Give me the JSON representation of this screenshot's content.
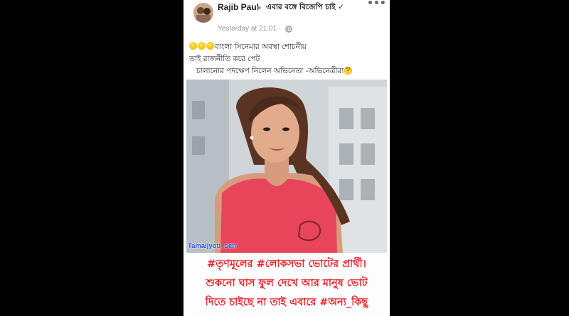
{
  "post": {
    "author": "Rajib Paul",
    "group": "এবার বঙ্গে বিজেপি চাই ✓",
    "timestamp": "Yesterday at 21:01 ·",
    "more_label": "•••",
    "text_lines": [
      "বাংলা সিনেমার অবস্থা শোচনীয়",
      "তাই রাজনীতি করে পেট",
      "চালানোর পদক্ষেপ নিলেন অভিনেতা -অভিনেত্রীরা🤔"
    ],
    "image": {
      "watermark": "Tamaljyoti_sen"
    },
    "caption_lines": [
      "#তৃণমূলের #লোকসভা ভোটের প্রার্থী।",
      "শুকনো ঘাস ফুল দেখে আর মানুষ ভোট",
      "দিতে চাইছে না তাই এবারে #অন্য_কিছু"
    ]
  },
  "icons": {
    "triangle": "right-triangle-icon",
    "globe": "globe-icon",
    "emoji": "grinning-emoji-icon"
  },
  "colors": {
    "background": "#000000",
    "card": "#ffffff",
    "name_text": "#1d2129",
    "meta_text": "#90949c",
    "caption_red": "#e8232a",
    "watermark_blue": "#1a4fd6",
    "shirt_pink": "#e8455a"
  }
}
